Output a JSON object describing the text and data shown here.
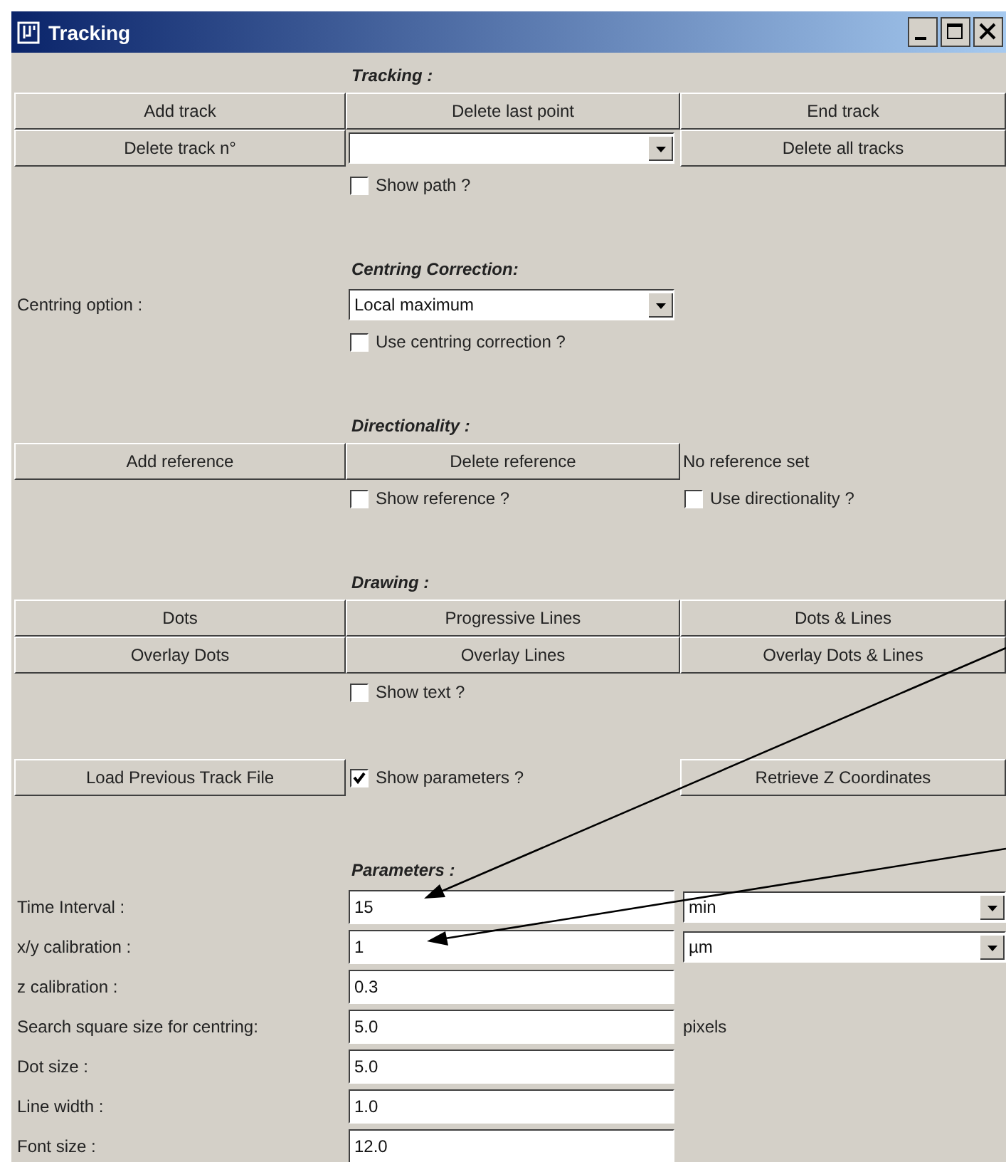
{
  "window": {
    "title": "Tracking"
  },
  "sections": [
    {
      "heading": "Tracking :",
      "rows": [
        {
          "cells": [
            {
              "kind": "button",
              "label": "Add track"
            },
            {
              "kind": "button",
              "label": "Delete last point"
            },
            {
              "kind": "button",
              "label": "End track"
            }
          ]
        },
        {
          "cells": [
            {
              "kind": "button",
              "label": "Delete track n°"
            },
            {
              "kind": "combo"
            },
            {
              "kind": "button",
              "label": "Delete all tracks"
            }
          ]
        },
        {
          "cells": [
            "",
            {
              "kind": "checkbox",
              "label": "Show path ?",
              "checked": false
            }
          ]
        }
      ]
    },
    {
      "heading": "Centring Correction:",
      "rows": [
        {
          "cells": [
            {
              "kind": "label",
              "label": "Centring option :"
            },
            {
              "kind": "combo",
              "value": "Local maximum"
            }
          ]
        },
        {
          "cells": [
            "",
            {
              "kind": "checkbox",
              "label": "Use centring correction ?",
              "checked": false
            }
          ]
        }
      ]
    },
    {
      "heading": "Directionality :",
      "rows": [
        {
          "cells": [
            {
              "kind": "button",
              "label": "Add reference"
            },
            {
              "kind": "button",
              "label": "Delete reference"
            },
            {
              "kind": "label",
              "label": "No reference set"
            }
          ]
        },
        {
          "cells": [
            "",
            {
              "kind": "checkbox",
              "label": "Show reference ?",
              "checked": false
            },
            {
              "kind": "checkbox",
              "label": "Use directionality ?",
              "checked": false
            }
          ]
        }
      ]
    },
    {
      "heading": "Drawing :",
      "rows": [
        {
          "cells": [
            {
              "kind": "button",
              "label": "Dots"
            },
            {
              "kind": "button",
              "label": "Progressive Lines"
            },
            {
              "kind": "button",
              "label": "Dots & Lines"
            }
          ]
        },
        {
          "cells": [
            {
              "kind": "button",
              "label": "Overlay Dots"
            },
            {
              "kind": "button",
              "label": "Overlay Lines"
            },
            {
              "kind": "button",
              "label": "Overlay Dots & Lines"
            }
          ]
        },
        {
          "cells": [
            "",
            {
              "kind": "checkbox",
              "label": "Show text ?",
              "checked": false
            }
          ]
        }
      ]
    },
    {
      "rows": [
        {
          "cells": [
            {
              "kind": "button",
              "label": "Load Previous Track File"
            },
            {
              "kind": "checkbox",
              "label": "Show parameters ?",
              "checked": true
            },
            {
              "kind": "button",
              "label": "Retrieve Z Coordinates"
            }
          ]
        }
      ]
    },
    {
      "heading": "Parameters :",
      "rows": [
        {
          "cells": [
            {
              "kind": "label",
              "label": "Time Interval :"
            },
            {
              "kind": "field",
              "value": "15"
            },
            {
              "kind": "combo",
              "value": "min"
            }
          ]
        },
        {
          "cells": [
            {
              "kind": "label",
              "label": "x/y calibration :"
            },
            {
              "kind": "field",
              "value": "1"
            },
            {
              "kind": "combo",
              "value": "µm"
            }
          ]
        },
        {
          "cells": [
            {
              "kind": "label",
              "label": "z calibration :"
            },
            {
              "kind": "field",
              "value": "0.3"
            }
          ]
        },
        {
          "cells": [
            {
              "kind": "label",
              "label": "Search square size for centring:"
            },
            {
              "kind": "field",
              "value": "5.0"
            },
            {
              "kind": "label",
              "label": "pixels"
            }
          ]
        },
        {
          "cells": [
            {
              "kind": "label",
              "label": "Dot size :"
            },
            {
              "kind": "field",
              "value": "5.0"
            }
          ]
        },
        {
          "cells": [
            {
              "kind": "label",
              "label": "Line width :"
            },
            {
              "kind": "field",
              "value": "1.0"
            }
          ]
        },
        {
          "cells": [
            {
              "kind": "label",
              "label": "Font size :"
            },
            {
              "kind": "field",
              "value": "12.0"
            }
          ]
        }
      ]
    }
  ]
}
